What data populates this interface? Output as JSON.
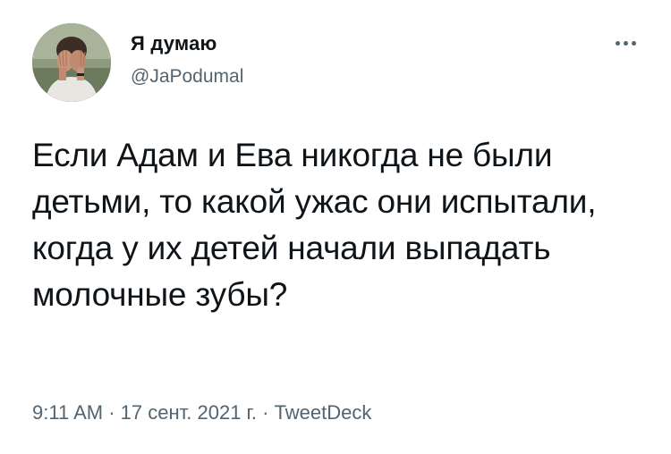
{
  "tweet": {
    "author": {
      "display_name": "Я думаю",
      "handle": "@JaPodumal",
      "avatar_icon": "person-covering-face-avatar"
    },
    "more_icon": "more-options-icon",
    "text": "Если Адам и Ева никогда не были детьми, то какой ужас они испытали, когда у их детей начали выпадать молочные зубы?",
    "meta": {
      "time": "9:11 AM",
      "separator1": " · ",
      "date": "17 сент. 2021 г.",
      "separator2": " · ",
      "source": "TweetDeck"
    },
    "colors": {
      "text": "#0f1419",
      "secondary": "#536471",
      "background": "#ffffff"
    }
  }
}
